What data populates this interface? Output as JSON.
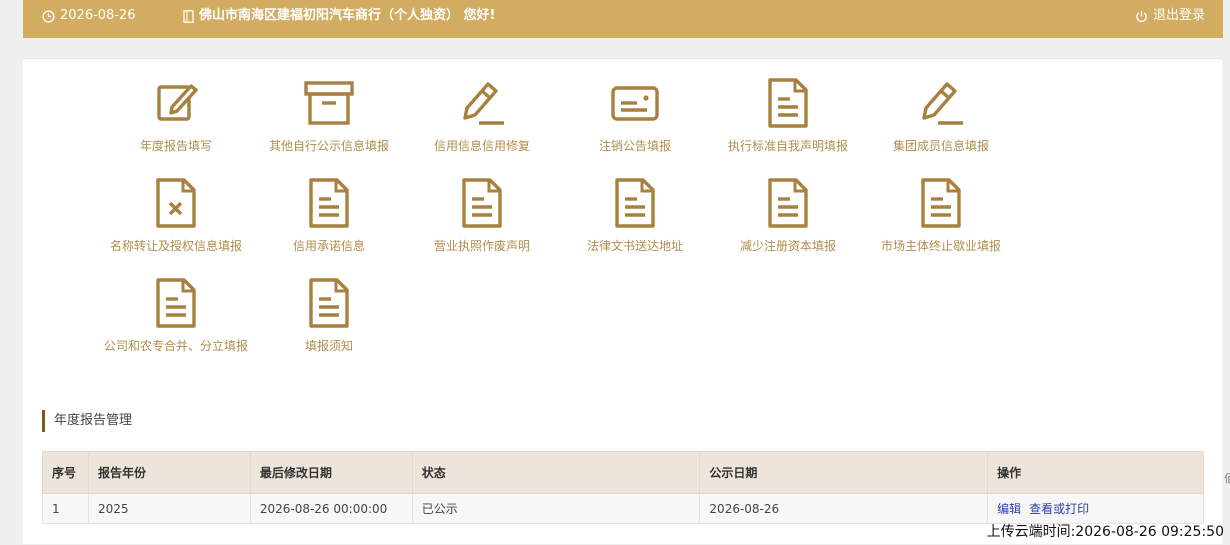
{
  "header": {
    "date": "2026-08-26",
    "company_greeting": "佛山市南海区建福初阳汽车商行（个人独资） 您好!",
    "logout_label": "退出登录"
  },
  "tiles": [
    {
      "label": "年度报告填写",
      "icon": "edit-icon"
    },
    {
      "label": "其他自行公示信息填报",
      "icon": "archive-box-icon"
    },
    {
      "label": "信用信息信用修复",
      "icon": "pencil-icon"
    },
    {
      "label": "注销公告填报",
      "icon": "id-card-icon"
    },
    {
      "label": "执行标准自我声明填报",
      "icon": "document-icon"
    },
    {
      "label": "集团成员信息填报",
      "icon": "pencil-icon"
    },
    {
      "label": "名称转让及授权信息填报",
      "icon": "document-x-icon"
    },
    {
      "label": "信用承诺信息",
      "icon": "document-icon"
    },
    {
      "label": "营业执照作废声明",
      "icon": "document-icon"
    },
    {
      "label": "法律文书送达地址",
      "icon": "document-icon"
    },
    {
      "label": "减少注册资本填报",
      "icon": "document-icon"
    },
    {
      "label": "市场主体终止歇业填报",
      "icon": "document-icon"
    },
    {
      "label": "公司和农专合并、分立填报",
      "icon": "document-icon"
    },
    {
      "label": "填报须知",
      "icon": "document-icon"
    }
  ],
  "annual_report": {
    "section_title": "年度报告管理",
    "columns": [
      "序号",
      "报告年份",
      "最后修改日期",
      "状态",
      "公示日期",
      "操作"
    ],
    "rows": [
      {
        "index": "1",
        "year": "2025",
        "modified": "2026-08-26 00:00:00",
        "status": "已公示",
        "publish_date": "2026-08-26",
        "action_edit": "编辑",
        "action_view": "查看或打印"
      }
    ]
  },
  "footer": {
    "upload_time": "上传云端时间:2026-08-26 09:25:50",
    "edge_char": "佰"
  },
  "colors": {
    "header_bg": "#d1ac61",
    "icon_gold": "#a8803f",
    "label_gold": "#b08d4d",
    "link_blue": "#2f3fa6"
  }
}
